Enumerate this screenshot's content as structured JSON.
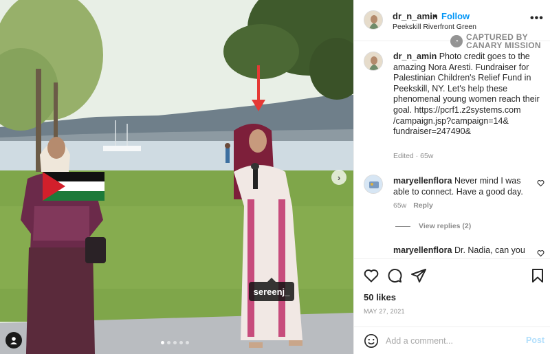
{
  "post": {
    "username": "dr_n_amin",
    "follow_label": "Follow",
    "separator": "•",
    "location": "Peekskill Riverfront Green",
    "more_label": "•••"
  },
  "watermark": {
    "line1": "CAPTURED BY",
    "line2": "CANARY MISSION"
  },
  "photo": {
    "tagged_user": "sereenj_",
    "carousel": {
      "total": 5,
      "current": 1
    }
  },
  "caption": {
    "username": "dr_n_amin",
    "text": "Photo credit goes to the amazing Nora Aresti. Fundraiser for Palestinian Children's Relief Fund in Peekskill, NY. Let's help these phenomenal young women reach their goal. https://pcrf1.z2systems.com /campaign.jsp?campaign=14& fundraiser=247490&",
    "meta": "Edited · 65w"
  },
  "comments": [
    {
      "username": "maryellenflora",
      "text": "Never mind I was able to connect. Have a good day.",
      "age": "65w",
      "reply_label": "Reply",
      "view_replies": "View replies (2)"
    },
    {
      "username": "maryellenflora",
      "text": "Dr. Nadia, can you"
    }
  ],
  "footer": {
    "likes": "50 likes",
    "date": "MAY 27, 2021",
    "comment_placeholder": "Add a comment...",
    "post_label": "Post"
  },
  "colors": {
    "accent": "#0095f6",
    "post_disabled": "#b2dffc",
    "secondary_text": "#8e8e8e",
    "arrow": "#e53935"
  }
}
